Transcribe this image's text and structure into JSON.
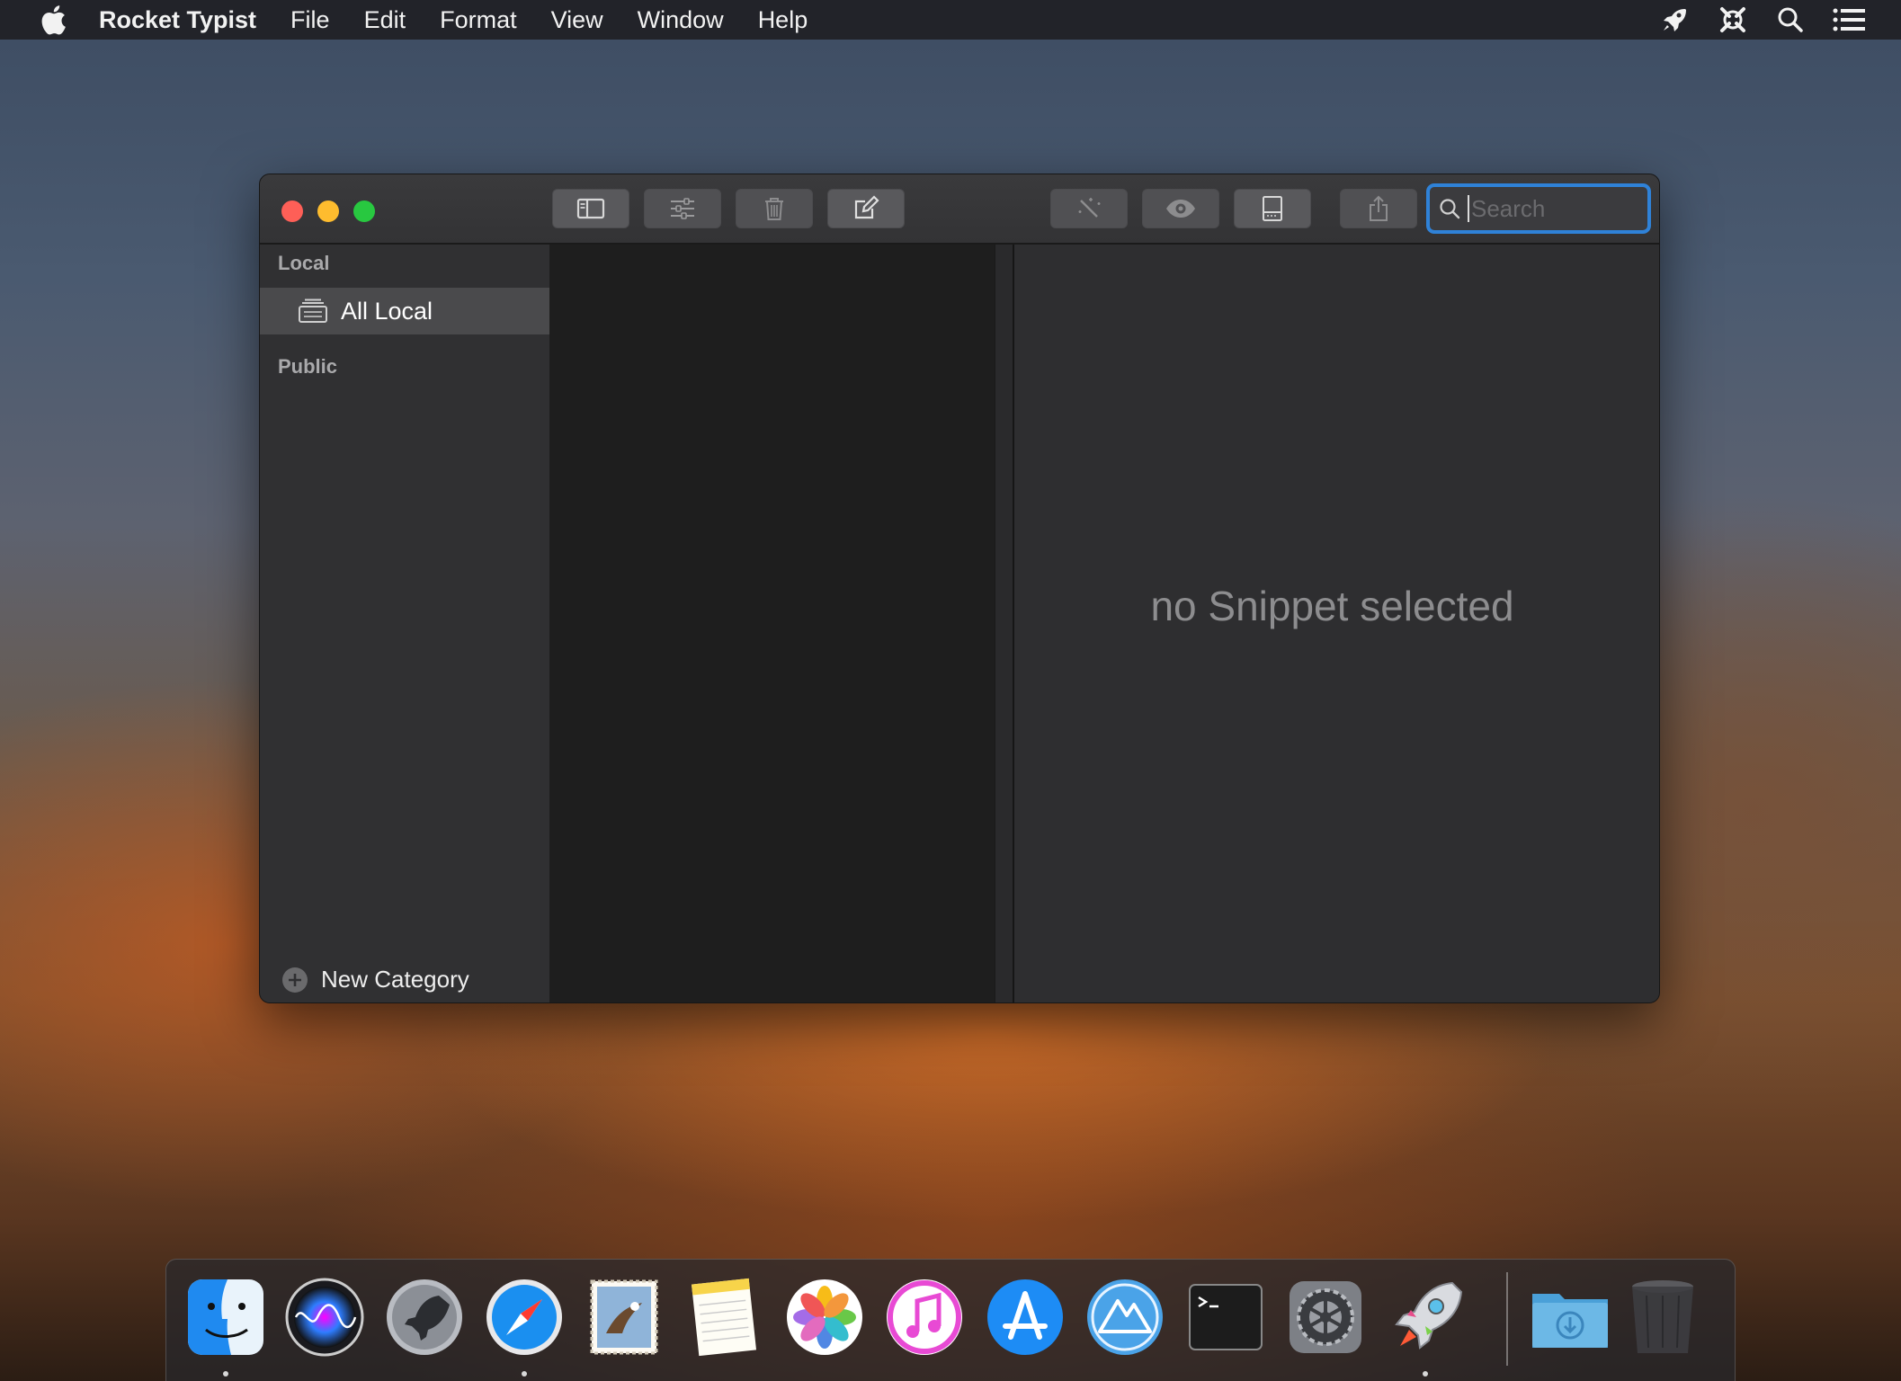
{
  "menubar": {
    "app_name": "Rocket Typist",
    "items": [
      "File",
      "Edit",
      "Format",
      "View",
      "Window",
      "Help"
    ],
    "right_icons": [
      "rocket-icon",
      "xcode-like-icon",
      "spotlight-search-icon",
      "notification-center-icon"
    ]
  },
  "window": {
    "toolbar": {
      "buttons": [
        "toggle-sidebar",
        "settings-sliders",
        "trash",
        "compose",
        "magic-wand",
        "preview-eye",
        "panel-layout",
        "share"
      ],
      "search_placeholder": "Search",
      "search_value": ""
    },
    "sidebar": {
      "local_header": "Local",
      "all_local": "All Local",
      "public_header": "Public",
      "new_category": "New Category"
    },
    "detail": {
      "empty_text": "no Snippet selected"
    }
  },
  "dock": {
    "apps": [
      "Finder",
      "Siri",
      "Launchpad",
      "Safari",
      "Mail",
      "Notes",
      "Photos",
      "iTunes",
      "App Store",
      "Instruments",
      "Terminal",
      "System Preferences",
      "Rocket Typist",
      "Downloads",
      "Trash"
    ],
    "running": [
      "Finder",
      "Safari",
      "Rocket Typist"
    ]
  },
  "colors": {
    "accent": "#2f82d8",
    "close": "#fe5f57",
    "minimize": "#febc2e",
    "maximize": "#28c840"
  }
}
